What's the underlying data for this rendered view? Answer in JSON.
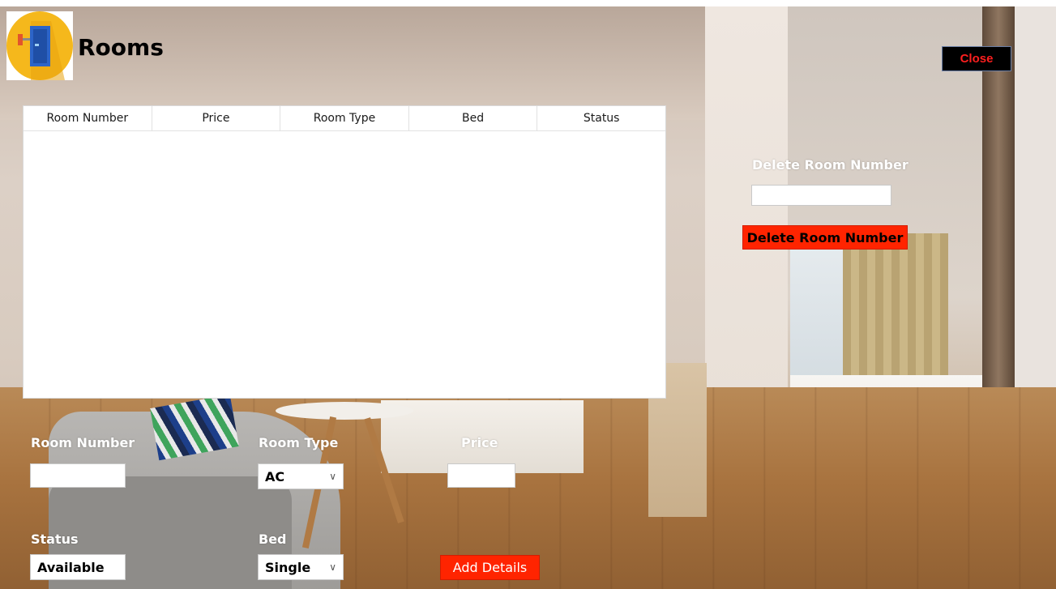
{
  "header": {
    "title": "Rooms",
    "close_label": "Close"
  },
  "table": {
    "columns": [
      "Room Number",
      "Price",
      "Room Type",
      "Bed",
      "Status"
    ],
    "rows": []
  },
  "delete_section": {
    "label": "Delete Room Number",
    "input_value": "",
    "button_label": "Delete Room Number"
  },
  "form": {
    "room_number_label": "Room Number",
    "room_number_value": "",
    "room_type_label": "Room Type",
    "room_type_value": "AC",
    "price_label": "Price",
    "price_value": "",
    "status_label": "Status",
    "status_value": "Available",
    "bed_label": "Bed",
    "bed_value": "Single",
    "add_button_label": "Add Details"
  },
  "colors": {
    "accent_red": "#ff2400",
    "close_text": "#ff1f1f",
    "close_bg": "#000000"
  },
  "icons": {
    "logo": "door-icon",
    "chevron": "chevron-down-icon"
  }
}
